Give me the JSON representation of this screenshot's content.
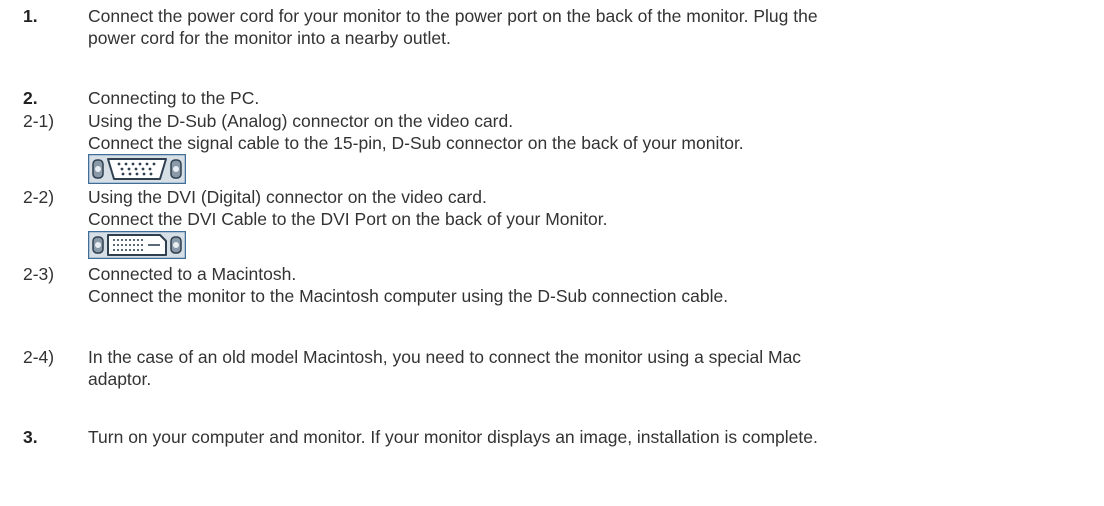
{
  "steps": [
    {
      "num": "1.",
      "lines": [
        "Connect the power cord for your monitor to the power port on the back of the monitor. Plug the",
        "power cord for the monitor into a nearby outlet."
      ]
    },
    {
      "num": "2.",
      "lines": [
        "Connecting to the PC."
      ]
    },
    {
      "num": "2-1)",
      "lines": [
        "Using the D-Sub (Analog) connector on the video card.",
        "Connect the signal cable to the 15-pin, D-Sub connector on the back of your monitor."
      ],
      "icon": "d-sub-connector-icon"
    },
    {
      "num": "2-2)",
      "lines": [
        "Using the DVI (Digital) connector on the video card.",
        "Connect the DVI Cable to the DVI Port on the back of your Monitor."
      ],
      "icon": "dvi-connector-icon"
    },
    {
      "num": "2-3)",
      "lines": [
        "Connected to a Macintosh.",
        "Connect the monitor to the Macintosh computer using the D-Sub connection cable."
      ]
    },
    {
      "num": "2-4)",
      "lines": [
        "In the case of an old model Macintosh, you need to connect the monitor using a special Mac",
        "adaptor."
      ]
    },
    {
      "num": "3.",
      "lines": [
        "Turn on your computer and monitor. If your monitor displays an image, installation is complete."
      ]
    }
  ],
  "colors": {
    "text": "#333333",
    "connector_border": "#4f7fa8",
    "connector_fill": "#cfd8e0"
  }
}
